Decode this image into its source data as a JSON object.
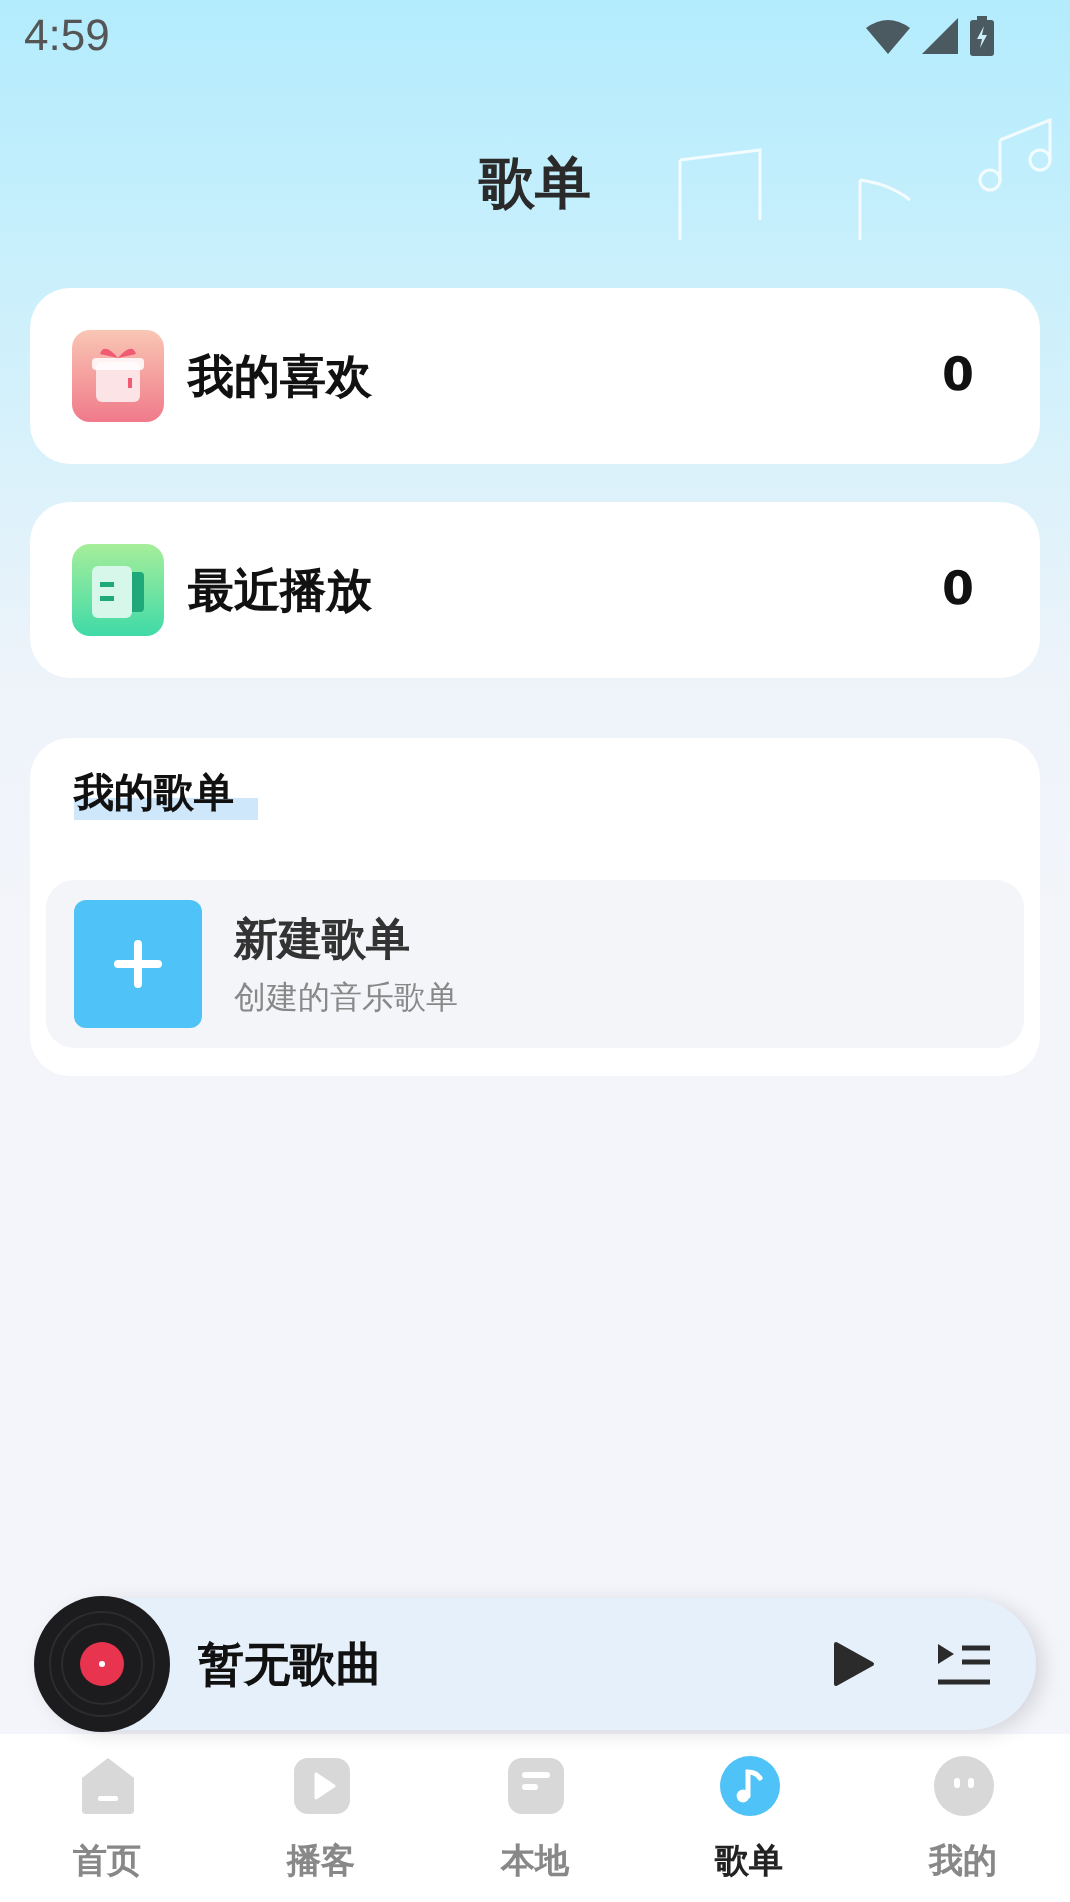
{
  "status_bar": {
    "time": "4:59"
  },
  "title": "歌单",
  "quick_lists": [
    {
      "kind": "favorites",
      "label": "我的喜欢",
      "count": "0"
    },
    {
      "kind": "recent",
      "label": "最近播放",
      "count": "0"
    }
  ],
  "my_playlists": {
    "heading": "我的歌单",
    "items": [
      {
        "kind": "create",
        "title": "新建歌单",
        "subtitle": "创建的音乐歌单"
      }
    ]
  },
  "player": {
    "song": "暂无歌曲"
  },
  "tabs": [
    {
      "kind": "home",
      "label": "首页",
      "selected": false
    },
    {
      "kind": "podcast",
      "label": "播客",
      "selected": false
    },
    {
      "kind": "local",
      "label": "本地",
      "selected": false
    },
    {
      "kind": "playlist",
      "label": "歌单",
      "selected": true
    },
    {
      "kind": "me",
      "label": "我的",
      "selected": false
    }
  ]
}
